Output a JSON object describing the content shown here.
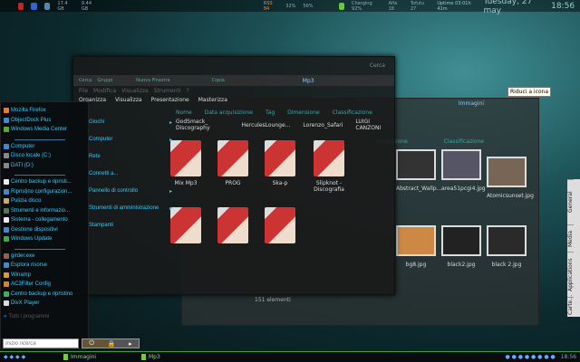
{
  "topbar": {
    "disk1": "17.4 GB",
    "disk2": "9.44 GB",
    "rss": "RSS 84",
    "cpu": "32%",
    "mem": "56%",
    "battery": "Charging 92%",
    "mail1": "Alfa 18",
    "mail2": "Tofutu 27",
    "uptime": "Uptime 03:01h 41m",
    "date": "Tuesday, 27 may",
    "time": "18:56"
  },
  "win1": {
    "title": "Mp3",
    "toolbar": [
      "Cerca",
      "Gruppi",
      "Nuova Finestra",
      "Copia"
    ],
    "search_placeholder": "Cerca",
    "menu": [
      "File",
      "Modifica",
      "Visualizza",
      "Strumenti",
      "?"
    ],
    "commands": [
      "Organizza",
      "Visualizza",
      "Presentazione",
      "Masterizza"
    ],
    "columns": [
      "Nome",
      "Data acquisizione",
      "Tag",
      "Dimensione",
      "Classificazione"
    ],
    "top_items": [
      "GodSmack_ Discography",
      "HerculesLounge...",
      "Lorenzo_Safari",
      "LUIGI CANZONI"
    ],
    "folders": [
      "Mix Mp3",
      "PROG",
      "Ska-p",
      "Slipknot - Discografia"
    ],
    "status": "151 elementi"
  },
  "win2": {
    "title": "Immagini",
    "columns": [
      "Dimensione",
      "Classificazione"
    ],
    "thumbs": [
      "Abstract_Wallp...",
      "area51pcgi4.jpg",
      "Atomicsunset.jpg",
      "bg8.jpg",
      "black2.jpg",
      "black 2.jpg"
    ]
  },
  "tooltip": "Riduci a icona",
  "start": {
    "items": [
      "Mozilla Firefox",
      "ObjectDock Plus",
      "Windows Media Center",
      "Computer",
      "Disco locale (C:)",
      "DATI (D:)",
      "Centro backup e ripristi...",
      "Ripristino configurazion...",
      "Pulizia disco",
      "Strumenti e informazio...",
      "Sistema - collegamento",
      "Gestione dispositivi",
      "Windows Update",
      "girder.exe",
      "Esplora risorse",
      "Winamp",
      "AC3Filter Config",
      "Centro backup e ripristino",
      "DivX Player"
    ],
    "all_programs": "Tutti i programmi",
    "search_placeholder": "Inizio ricerca",
    "right": [
      "Giochi",
      "Computer",
      "Rete",
      "Connetti a...",
      "Pannello di controllo",
      "Strumenti di amministrazione",
      "Stampanti"
    ]
  },
  "sidebar_tabs": [
    "General",
    "Media",
    "Applications",
    "Carte..."
  ],
  "taskbar": {
    "items": [
      "Immagini",
      "Mp3"
    ],
    "time": "18:56"
  }
}
